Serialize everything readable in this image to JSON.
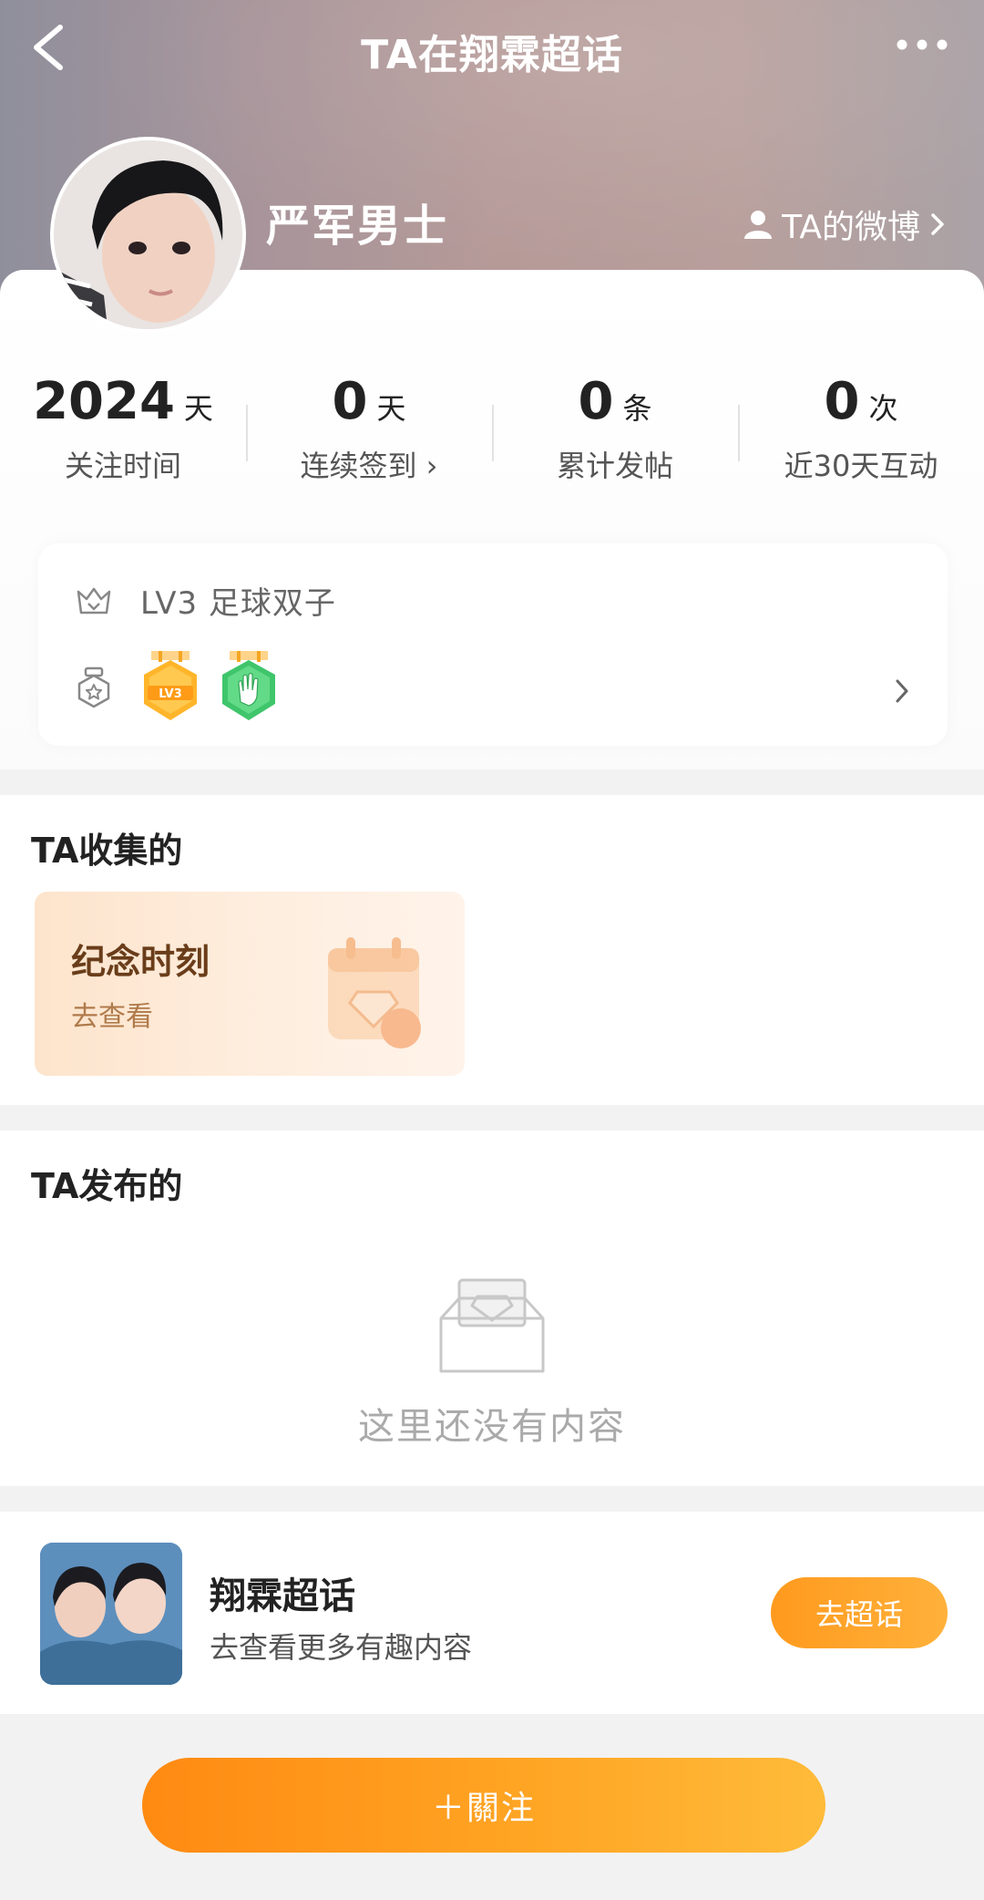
{
  "nav": {
    "title": "TA在翔霖超话",
    "back_icon": "back-arrow-icon",
    "more_icon": "more-dots-icon"
  },
  "profile": {
    "username": "严军男士",
    "weibo_link": "TA的微博",
    "avatar": "avatar-photo"
  },
  "stats": [
    {
      "value": "2024",
      "unit": "天",
      "label": "关注时间"
    },
    {
      "value": "0",
      "unit": "天",
      "label": "连续签到 ›"
    },
    {
      "value": "0",
      "unit": "条",
      "label": "累计发帖"
    },
    {
      "value": "0",
      "unit": "次",
      "label": "近30天互动"
    }
  ],
  "level": {
    "text": "LV3 足球双子",
    "badge_lv_text": "LV3"
  },
  "collected": {
    "title": "TA收集的",
    "card_title": "纪念时刻",
    "card_sub": "去查看"
  },
  "posted": {
    "title": "TA发布的",
    "empty_text": "这里还没有内容"
  },
  "topic": {
    "name": "翔霖超话",
    "desc": "去查看更多有趣内容",
    "button": "去超话"
  },
  "footer": {
    "follow_button": "＋關注"
  },
  "colors": {
    "accent": "#ff9a1e",
    "header_bg": "#b59a98"
  }
}
